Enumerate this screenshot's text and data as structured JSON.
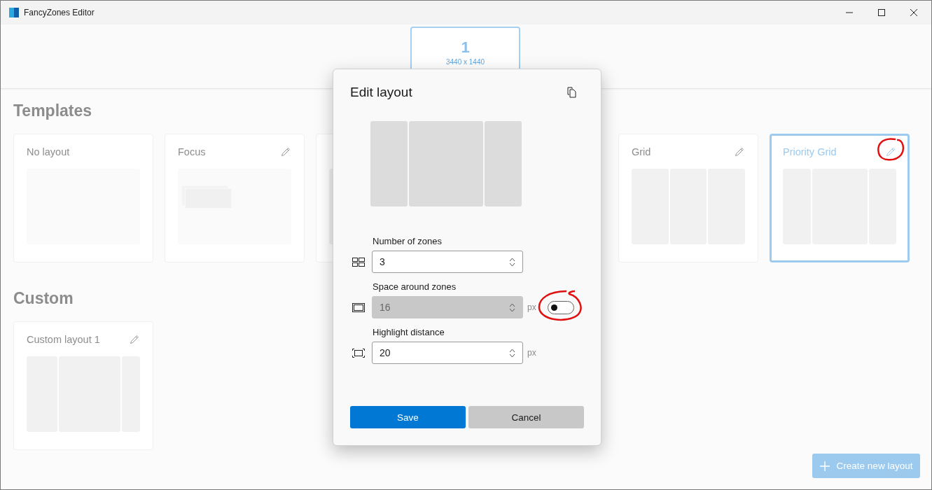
{
  "window": {
    "title": "FancyZones Editor"
  },
  "monitors": [
    {
      "number": "1",
      "resolution": "3440 x 1440",
      "selected": true
    }
  ],
  "templates": {
    "heading": "Templates",
    "cards": [
      {
        "title": "No layout",
        "editable": false,
        "selected": false,
        "preview": {
          "kind": "blank"
        }
      },
      {
        "title": "Focus",
        "editable": true,
        "selected": false,
        "preview": {
          "kind": "focus"
        }
      },
      {
        "editable": false,
        "selected": false,
        "preview": {
          "kind": "cut"
        }
      },
      {
        "title": "Grid",
        "editable": true,
        "selected": false,
        "preview": {
          "kind": "grid"
        }
      },
      {
        "title": "Priority Grid",
        "editable": true,
        "selected": true,
        "preview": {
          "kind": "priority-grid"
        }
      }
    ]
  },
  "custom": {
    "heading": "Custom",
    "cards": [
      {
        "title": "Custom layout 1",
        "editable": true,
        "selected": false,
        "preview": {
          "kind": "custom"
        }
      }
    ]
  },
  "create_button": {
    "label": "Create new layout",
    "disabled": true
  },
  "dialog": {
    "title": "Edit layout",
    "preview": {
      "kind": "priority-grid"
    },
    "fields": [
      {
        "label": "Number of zones",
        "value": "3",
        "disabled": false
      },
      {
        "label": "Space around zones",
        "value": "16",
        "disabled": true,
        "unit": "px",
        "toggle": {
          "on": false
        }
      },
      {
        "label": "Highlight distance",
        "value": "20",
        "disabled": false,
        "unit": "px"
      }
    ],
    "buttons": [
      {
        "label": "Save",
        "kind": "primary"
      },
      {
        "label": "Cancel",
        "kind": "secondary"
      }
    ]
  }
}
